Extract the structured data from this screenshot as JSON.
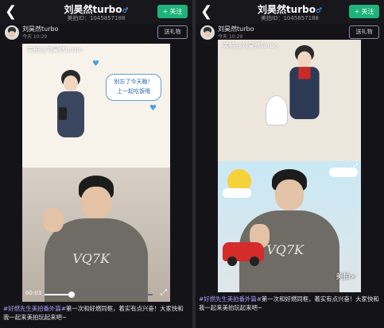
{
  "left": {
    "header": {
      "back_glyph": "❮",
      "title": "刘昊然turbo",
      "gender_glyph": "♂",
      "id_line": "美拍ID：1045857188",
      "follow_label": "关注",
      "follow_plus": "+"
    },
    "user": {
      "name": "刘昊然turbo",
      "time": "今天 10:29",
      "gift_label": "送礼物"
    },
    "video": {
      "watermark": "美拍@刘昊然turbo",
      "bubble_line1": "别忘了今天晚！",
      "bubble_line2": "上一起吃饭哦",
      "time": "00:03",
      "progress": 0.25,
      "hoodie_text": "VQ7K",
      "expand_glyph": "⤢"
    },
    "caption": {
      "tag": "#好燃先生美拍番外篇#",
      "text": "第一次和好燃同框，着实有点兴奋！大家快和我一起来美拍玩起来吧~"
    }
  },
  "right": {
    "header": {
      "back_glyph": "❮",
      "title": "刘昊然turbo",
      "gender_glyph": "♂",
      "id_line": "美拍ID：1045857188",
      "follow_label": "关注",
      "follow_plus": "+"
    },
    "user": {
      "name": "刘昊然turbo",
      "time": "今天 10:29",
      "gift_label": "送礼物"
    },
    "video": {
      "watermark": "美拍@刘昊然turbo",
      "hoodie_text": "VQ7K",
      "brand": "美拍×",
      "expand_glyph": "⤢"
    },
    "caption": {
      "tag": "#好燃先生美拍番外篇#",
      "text": "第一次和好燃同框，着实有点兴奋！大家快和我一起来美拍玩起来吧~"
    }
  },
  "colors": {
    "accent_green": "#1fb37a",
    "tag_purple": "#a99cf5"
  }
}
